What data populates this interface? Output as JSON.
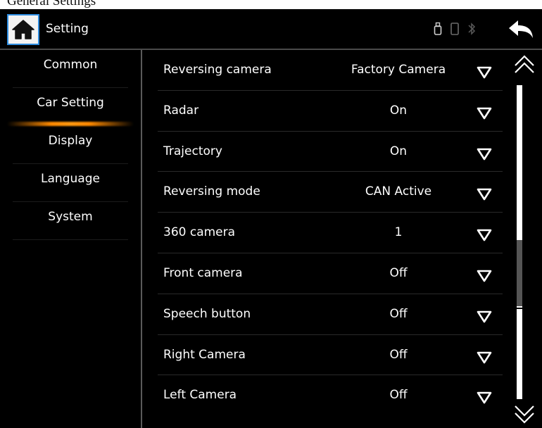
{
  "caption": "General Settings",
  "header": {
    "title": "Setting",
    "home_icon": "home-icon",
    "back_icon": "back-arrow-icon",
    "status_icons": [
      "usb-icon",
      "phone-icon",
      "bluetooth-icon"
    ]
  },
  "sidebar": {
    "items": [
      {
        "label": "Common",
        "active": false
      },
      {
        "label": "Car Setting",
        "active": true
      },
      {
        "label": "Display",
        "active": false
      },
      {
        "label": "Language",
        "active": false
      },
      {
        "label": "System",
        "active": false
      }
    ]
  },
  "settings": [
    {
      "label": "Reversing camera",
      "value": "Factory Camera"
    },
    {
      "label": "Radar",
      "value": "On"
    },
    {
      "label": "Trajectory",
      "value": "On"
    },
    {
      "label": "Reversing mode",
      "value": "CAN Active"
    },
    {
      "label": "360 camera",
      "value": "1"
    },
    {
      "label": "Front camera",
      "value": "Off"
    },
    {
      "label": "Speech button",
      "value": "Off"
    },
    {
      "label": "Right Camera",
      "value": "Off"
    },
    {
      "label": "Left Camera",
      "value": "Off"
    }
  ],
  "scrollbar": {
    "up_icon": "double-chevron-up-icon",
    "down_icon": "double-chevron-down-icon"
  },
  "colors": {
    "accent": "#2f8de0",
    "active_highlight": "#ff8a00",
    "background": "#000000",
    "text": "#ffffff"
  }
}
